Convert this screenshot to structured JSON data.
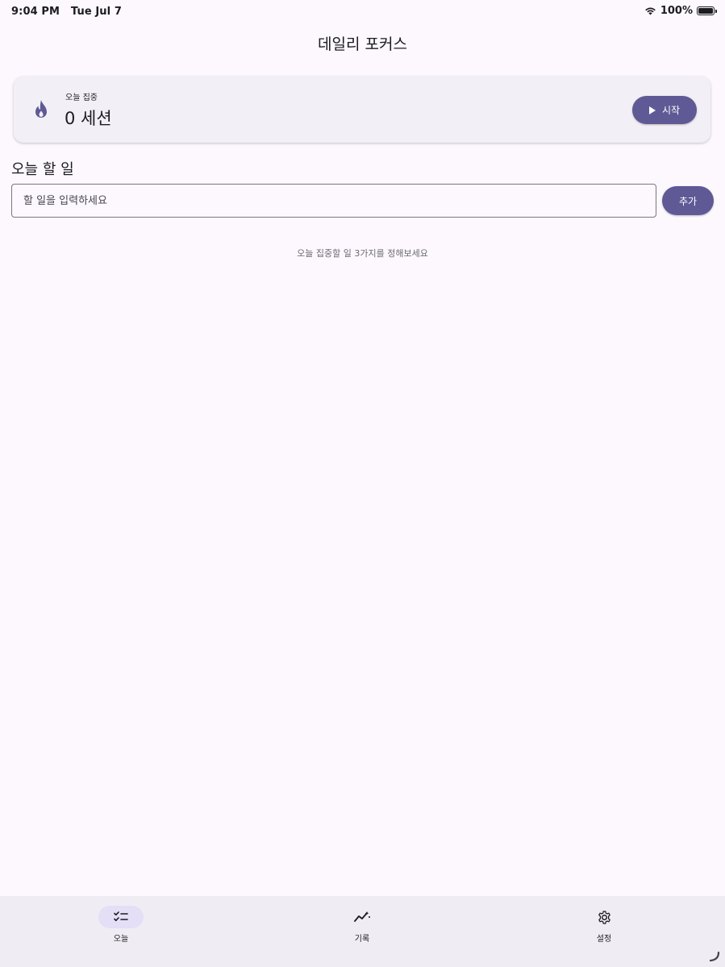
{
  "status_bar": {
    "time": "9:04 PM",
    "date": "Tue Jul 7",
    "battery": "100%"
  },
  "app_bar": {
    "title": "데일리 포커스"
  },
  "focus_card": {
    "label": "오늘 집중",
    "count": "0 세션",
    "start_button": "시작",
    "icon": "flame-icon"
  },
  "tasks": {
    "title": "오늘 할 일",
    "input_placeholder": "할 일을 입력하세요",
    "input_value": "",
    "add_button": "추가",
    "empty_hint": "오늘 집중할 일 3가지를 정해보세요"
  },
  "bottom_nav": {
    "items": [
      {
        "label": "오늘",
        "icon": "checklist-icon",
        "active": true
      },
      {
        "label": "기록",
        "icon": "trending-icon",
        "active": false
      },
      {
        "label": "설정",
        "icon": "gear-icon",
        "active": false
      }
    ]
  },
  "colors": {
    "primary": "#5f5a95",
    "background": "#fcf8fe",
    "card": "#f3eff6",
    "nav_background": "#f0ecf4",
    "nav_active_indicator": "#e4dff7"
  }
}
